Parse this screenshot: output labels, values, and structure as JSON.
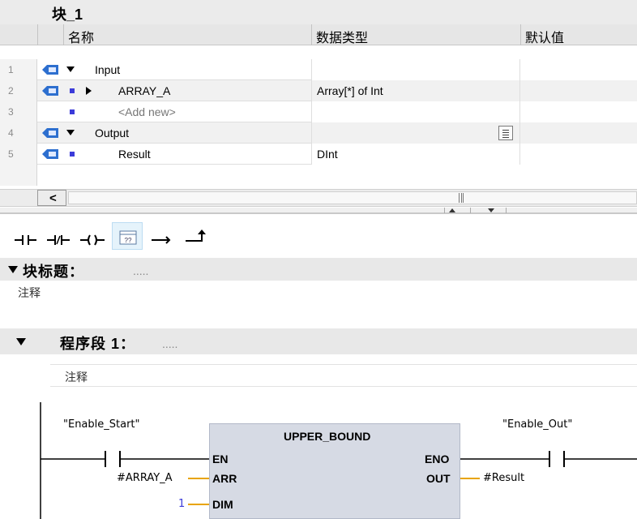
{
  "interface": {
    "block_name": "块_1",
    "columns": {
      "name": "名称",
      "data_type": "数据类型",
      "default_value": "默认值"
    },
    "rows": [
      {
        "num": "1",
        "name": "Input",
        "type": ""
      },
      {
        "num": "2",
        "name": "ARRAY_A",
        "type": "Array[*] of Int"
      },
      {
        "num": "3",
        "name": "<Add new>",
        "type": ""
      },
      {
        "num": "4",
        "name": "Output",
        "type": ""
      },
      {
        "num": "5",
        "name": "Result",
        "type": "DInt"
      }
    ]
  },
  "toolbar": {
    "items": [
      "normally-open-contact",
      "normally-closed-contact",
      "coil",
      "empty-box",
      "open-branch",
      "close-branch"
    ],
    "empty_box_label": "??"
  },
  "block_section": {
    "title": "块标题：",
    "title_placeholder": ".....",
    "comment": "注释"
  },
  "network": {
    "title": "程序段 1：",
    "title_placeholder": ".....",
    "comment": "注释",
    "ladder": {
      "contact_in_label": "\"Enable_Start\"",
      "contact_out_label": "\"Enable_Out\"",
      "box_title": "UPPER_BOUND",
      "pins": {
        "en": "EN",
        "eno": "ENO",
        "arr": "ARR",
        "out": "OUT",
        "dim": "DIM"
      },
      "arr_operand": "#ARRAY_A",
      "out_operand": "#Result",
      "dim_operand": "1"
    }
  },
  "colors": {
    "accent_blue": "#3b3bd9",
    "operand_line": "#e8a400",
    "box_fill": "#d6dae4"
  }
}
